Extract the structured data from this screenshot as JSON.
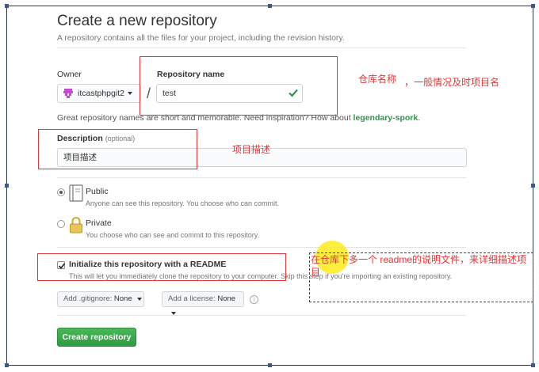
{
  "header": {
    "title": "Create a new repository",
    "subtitle": "A repository contains all the files for your project, including the revision history."
  },
  "owner": {
    "label": "Owner",
    "value": "itcastphpgit2"
  },
  "repo_name": {
    "label": "Repository name",
    "value": "test"
  },
  "separator": "/",
  "hint": {
    "prefix": "Great repository names are short and memorable. Need inspiration? How about ",
    "suggestion": "legendary-spork",
    "suffix": "."
  },
  "description": {
    "label": "Description",
    "optional": "(optional)",
    "value": "项目描述"
  },
  "visibility": {
    "public": {
      "title": "Public",
      "note": "Anyone can see this repository. You choose who can commit.",
      "selected": true
    },
    "private": {
      "title": "Private",
      "note": "You choose who can see and commit to this repository.",
      "selected": false
    }
  },
  "init": {
    "label": "Initialize this repository with a README",
    "note": "This will let you immediately clone the repository to your computer. Skip this step if you're importing an existing repository.",
    "checked": true
  },
  "gitignore": {
    "prefix": "Add .gitignore:",
    "value": "None"
  },
  "license": {
    "prefix": "Add a license:",
    "value": "None"
  },
  "info_glyph": "i",
  "create_button": "Create repository",
  "annotations": {
    "repo_name_note_1": "仓库名称",
    "repo_name_note_2": "，一般情况及时项目名",
    "description_note": "项目描述",
    "readme_note": "在仓库下多一个  readme的说明文件，来详细描述项目"
  },
  "colors": {
    "accent_green": "#2f9a40",
    "annotation_red": "#e0383a",
    "check_green": "#2c974b"
  }
}
